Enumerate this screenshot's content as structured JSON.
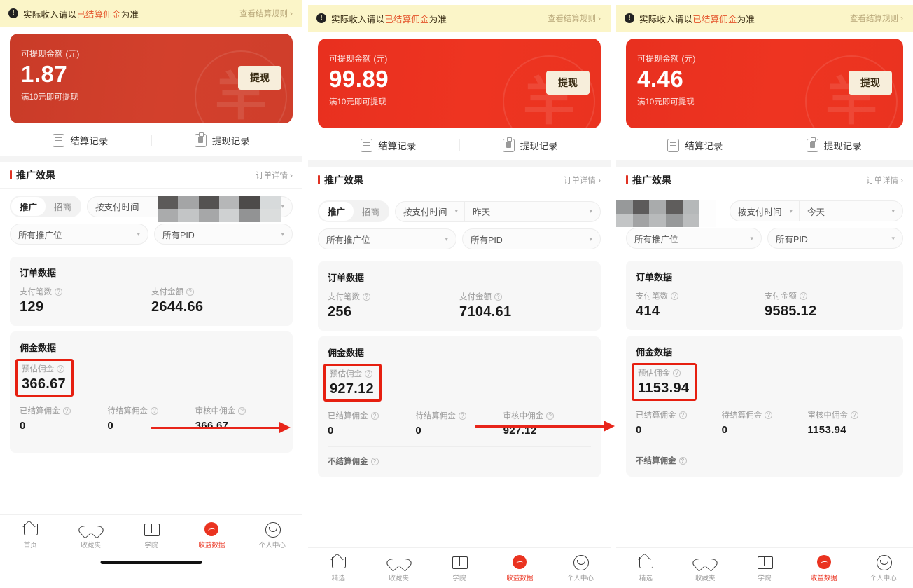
{
  "notice": {
    "icon": "exclamation-circle-icon",
    "prefix": "实际收入请以",
    "highlight": "已结算佣金",
    "suffix": "为准",
    "link": "查看结算规则 ›"
  },
  "balance_card": {
    "label": "可提现金额 (元)",
    "note": "满10元即可提现",
    "withdraw_label": "提现",
    "watermark": "羊"
  },
  "records": {
    "settlement": "结算记录",
    "withdraw": "提现记录"
  },
  "promotion": {
    "title": "推广效果",
    "more": "订单详情 ›",
    "seg_on": "推广",
    "seg_off": "招商",
    "time_mode": "按支付时间",
    "slot_all": "所有推广位",
    "pid_all": "所有PID"
  },
  "order_section": {
    "title": "订单数据",
    "count_label": "支付笔数",
    "amount_label": "支付金额"
  },
  "commission_section": {
    "title": "佣金数据",
    "estimated_label": "预估佣金",
    "settled_label": "已结算佣金",
    "pending_label": "待结算佣金",
    "reviewing_label": "审核中佣金",
    "unsettled_label": "不结算佣金"
  },
  "tabbar": {
    "items_p1": [
      {
        "label": "首页",
        "icon": "home-icon",
        "active": false
      },
      {
        "label": "收藏夹",
        "icon": "heart-icon",
        "active": false
      },
      {
        "label": "学院",
        "icon": "book-icon",
        "active": false
      },
      {
        "label": "收益数据",
        "icon": "earnings-icon",
        "active": true
      },
      {
        "label": "个人中心",
        "icon": "user-circle-icon",
        "active": false
      }
    ],
    "items_p2": [
      {
        "label": "精选",
        "icon": "home-icon",
        "active": false
      },
      {
        "label": "收藏夹",
        "icon": "heart-icon",
        "active": false
      },
      {
        "label": "学院",
        "icon": "book-icon",
        "active": false
      },
      {
        "label": "收益数据",
        "icon": "earnings-icon",
        "active": true
      },
      {
        "label": "个人中心",
        "icon": "user-circle-icon",
        "active": false
      }
    ],
    "items_p3": [
      {
        "label": "精选",
        "icon": "home-icon",
        "active": false
      },
      {
        "label": "收藏夹",
        "icon": "heart-icon",
        "active": false
      },
      {
        "label": "学院",
        "icon": "book-icon",
        "active": false
      },
      {
        "label": "收益数据",
        "icon": "earnings-icon",
        "active": true
      },
      {
        "label": "个人中心",
        "icon": "user-circle-icon",
        "active": false
      }
    ]
  },
  "panels": [
    {
      "id": "panel-1",
      "balance": "1.87",
      "date_filter": "",
      "date_redacted": true,
      "seg_redacted": false,
      "paid_count": "129",
      "paid_amount": "2644.66",
      "estimated": "366.67",
      "settled": "0",
      "pending": "0",
      "reviewing": "366.67",
      "show_unsettled": false
    },
    {
      "id": "panel-2",
      "balance": "99.89",
      "date_filter": "昨天",
      "date_redacted": false,
      "seg_redacted": false,
      "paid_count": "256",
      "paid_amount": "7104.61",
      "estimated": "927.12",
      "settled": "0",
      "pending": "0",
      "reviewing": "927.12",
      "show_unsettled": true
    },
    {
      "id": "panel-3",
      "balance": "4.46",
      "date_filter": "今天",
      "date_redacted": false,
      "seg_redacted": true,
      "paid_count": "414",
      "paid_amount": "9585.12",
      "estimated": "1153.94",
      "settled": "0",
      "pending": "0",
      "reviewing": "1153.94",
      "show_unsettled": true
    }
  ],
  "colors": {
    "brand_red": "#ea3320",
    "card_red_dull": "#cf3e2b",
    "notice_yellow": "#fbf5c8",
    "highlight_box": "#e61f10",
    "withdraw_cream": "#f7eedb"
  }
}
